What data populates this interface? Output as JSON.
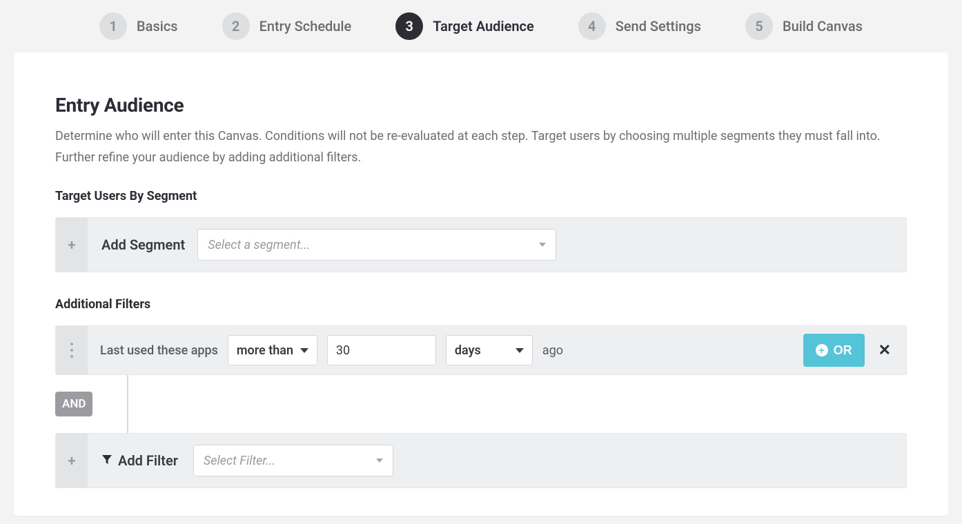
{
  "stepper": {
    "steps": [
      {
        "num": "1",
        "label": "Basics",
        "active": false
      },
      {
        "num": "2",
        "label": "Entry Schedule",
        "active": false
      },
      {
        "num": "3",
        "label": "Target Audience",
        "active": true
      },
      {
        "num": "4",
        "label": "Send Settings",
        "active": false
      },
      {
        "num": "5",
        "label": "Build Canvas",
        "active": false
      }
    ]
  },
  "section": {
    "title": "Entry Audience",
    "desc": "Determine who will enter this Canvas. Conditions will not be re-evaluated at each step. Target users by choosing multiple segments they must fall into. Further refine your audience by adding additional filters."
  },
  "segment": {
    "heading": "Target Users By Segment",
    "row_label": "Add Segment",
    "placeholder": "Select a segment..."
  },
  "filters": {
    "heading": "Additional Filters",
    "row1": {
      "prefix": "Last used these apps",
      "comparator": "more than",
      "value": "30",
      "unit": "days",
      "suffix": "ago"
    },
    "and_label": "AND",
    "or_label": "OR",
    "add_filter_label": "Add Filter",
    "add_filter_placeholder": "Select Filter..."
  }
}
